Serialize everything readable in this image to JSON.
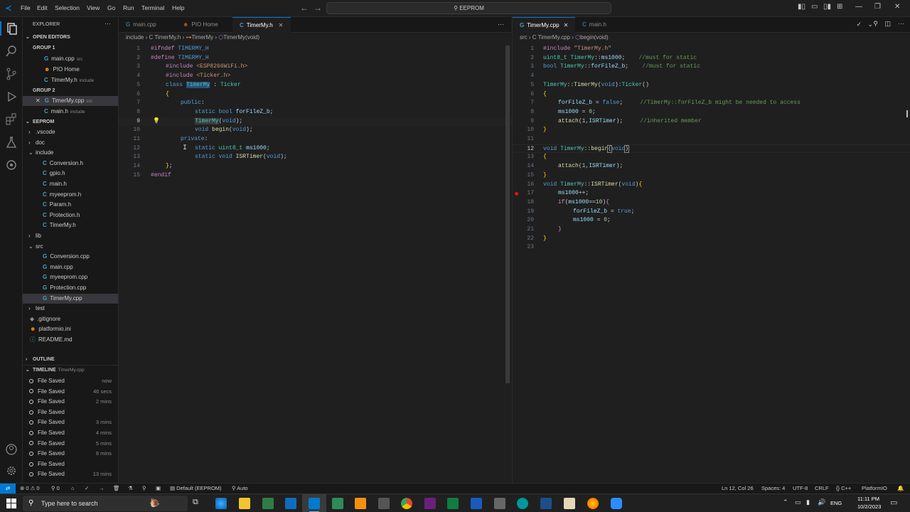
{
  "menu": [
    "File",
    "Edit",
    "Selection",
    "View",
    "Go",
    "Run",
    "Terminal",
    "Help"
  ],
  "search_text": "EEPROM",
  "explorer": {
    "title": "EXPLORER",
    "open_editors": "OPEN EDITORS",
    "group1": "GROUP 1",
    "group1_items": [
      {
        "name": "main.cpp",
        "tag": "src"
      },
      {
        "name": "PIO Home",
        "tag": ""
      },
      {
        "name": "TimerMy.h",
        "tag": "include"
      }
    ],
    "group2": "GROUP 2",
    "group2_items": [
      {
        "name": "TimerMy.cpp",
        "tag": "src"
      },
      {
        "name": "main.h",
        "tag": "include"
      }
    ],
    "project": "EEPROM",
    "tree": [
      ".vscode",
      "doc",
      "include",
      "Conversion.h",
      "gpio.h",
      "main.h",
      "myeeprom.h",
      "Param.h",
      "Protection.h",
      "TimerMy.h",
      "lib",
      "src",
      "Conversion.cpp",
      "main.cpp",
      "myeeprom.cpp",
      "Protection.cpp",
      "TimerMy.cpp",
      "test",
      ".gitignore",
      "platformio.ini",
      "README.md"
    ],
    "outline": "OUTLINE",
    "timeline": "TIMELINE",
    "timeline_file": "TimerMy.cpp",
    "timeline_items": [
      {
        "label": "File Saved",
        "time": "now"
      },
      {
        "label": "File Saved",
        "time": "46 secs"
      },
      {
        "label": "File Saved",
        "time": "2 mins"
      },
      {
        "label": "File Saved",
        "time": ""
      },
      {
        "label": "File Saved",
        "time": "3 mins"
      },
      {
        "label": "File Saved",
        "time": "4 mins"
      },
      {
        "label": "File Saved",
        "time": "5 mins"
      },
      {
        "label": "File Saved",
        "time": "8 mins"
      },
      {
        "label": "File Saved",
        "time": ""
      },
      {
        "label": "File Saved",
        "time": "13 mins"
      }
    ]
  },
  "left_editor": {
    "tabs": [
      "main.cpp",
      "PIO Home",
      "TimerMy.h"
    ],
    "breadcrumb": [
      "include",
      "C TimerMy.h",
      "TimerMy",
      "TimerMy(void)"
    ]
  },
  "right_editor": {
    "tabs": [
      "TimerMy.cpp",
      "main.h"
    ],
    "breadcrumb": [
      "src",
      "C TimerMy.cpp",
      "begin(void)"
    ]
  },
  "status": {
    "problems": "⊗ 0 ⚠ 0",
    "ports": "⚲ 0",
    "env": "Default (EEPROM)",
    "auto": "Auto",
    "position": "Ln 12, Col 26",
    "spaces": "Spaces: 4",
    "encoding": "UTF-8",
    "eol": "CRLF",
    "lang": "{} C++",
    "platform": "PlatformIO"
  },
  "taskbar": {
    "search_placeholder": "Type here to search",
    "lang": "ENG",
    "time": "11:11 PM",
    "date": "10/2/2023"
  },
  "colors": {
    "accent": "#0078d4",
    "editor_bg": "#1f1f1f",
    "sidebar_bg": "#181818"
  }
}
